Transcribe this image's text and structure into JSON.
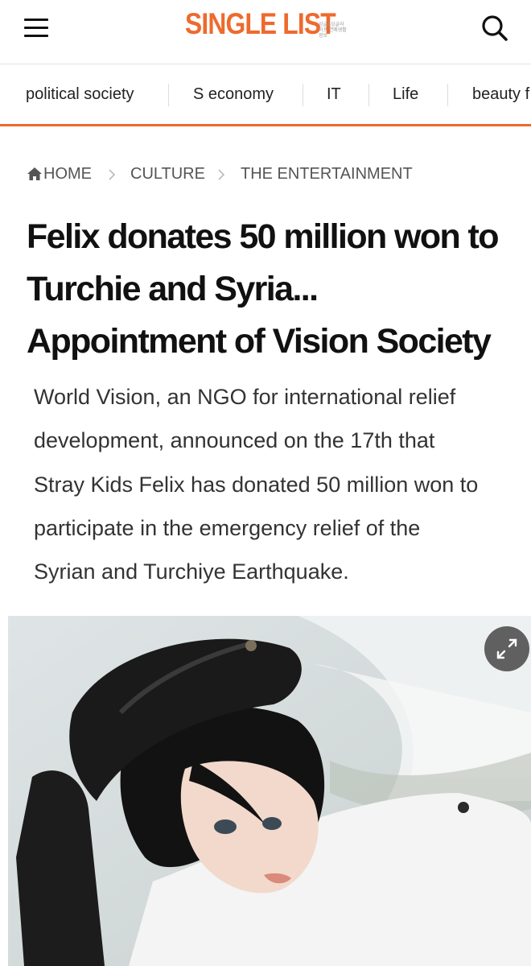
{
  "header": {
    "logo_text": "SINGLE LIST",
    "logo_sub": "싱글&싱글라이프 연예생활정보",
    "menu_icon": "hamburger-menu-icon",
    "search_icon": "search-icon"
  },
  "nav": {
    "items": [
      {
        "label": "political society"
      },
      {
        "label": "S economy"
      },
      {
        "label": "IT"
      },
      {
        "label": "Life"
      },
      {
        "label": "beauty f"
      }
    ],
    "accent_color": "#ee6a2d"
  },
  "breadcrumb": {
    "home": "HOME",
    "items": [
      "CULTURE",
      "THE ENTERTAINMENT"
    ]
  },
  "article": {
    "title_lines": [
      "Felix donates 50 million won to",
      "Turchie and Syria...",
      "Appointment of Vision Society"
    ],
    "summary_lines": [
      "World Vision, an NGO for international relief",
      "development, announced on the 17th that",
      "Stray Kids Felix has donated 50 million won to",
      "participate in the emergency relief of the",
      "Syrian and Turchiye Earthquake."
    ],
    "expand_icon": "expand-icon"
  }
}
